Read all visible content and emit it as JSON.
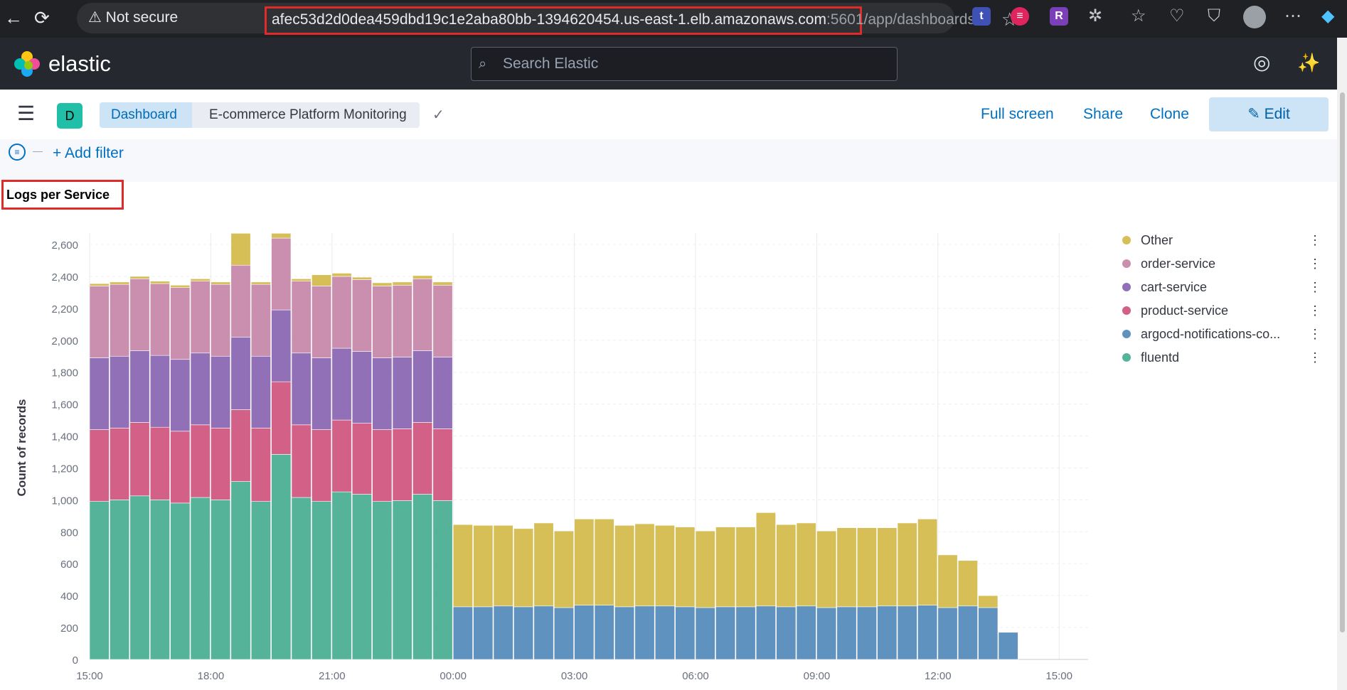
{
  "browser": {
    "back_icon": "←",
    "reload_icon": "⟳",
    "security_label": "Not secure",
    "url_main": "afec53d2d0dea459dbd19c1e2aba80bb-1394620454.us-east-1.elb.amazonaws.com",
    "url_port": ":5601/app/dashboards#/...",
    "extensions": [
      {
        "name": "t",
        "color": "#3f51b5"
      },
      {
        "name": "≡",
        "color": "#e0245e"
      },
      {
        "name": "R",
        "color": "#7b3fb8"
      }
    ]
  },
  "kibana": {
    "brand": "elastic",
    "search_placeholder": "Search Elastic"
  },
  "toolbar": {
    "space_initial": "D",
    "breadcrumb_root": "Dashboard",
    "breadcrumb_current": "E-commerce Platform Monitoring",
    "full_screen": "Full screen",
    "share": "Share",
    "clone": "Clone",
    "edit": "Edit"
  },
  "filter": {
    "add_filter": "+ Add filter"
  },
  "panel": {
    "title": "Logs per Service"
  },
  "legend": [
    {
      "name": "Other",
      "color": "#d6bf57"
    },
    {
      "name": "order-service",
      "color": "#ca8eae"
    },
    {
      "name": "cart-service",
      "color": "#9170b8"
    },
    {
      "name": "product-service",
      "color": "#d36086"
    },
    {
      "name": "argocd-notifications-co...",
      "color": "#6092c0"
    },
    {
      "name": "fluentd",
      "color": "#54b399"
    }
  ],
  "chart_data": {
    "type": "bar",
    "stacked": true,
    "ylabel": "Count of records",
    "ylim": [
      0,
      2700
    ],
    "yticks": [
      0,
      200,
      400,
      600,
      800,
      1000,
      1200,
      1400,
      1600,
      1800,
      2000,
      2200,
      2400,
      2600
    ],
    "xticks": [
      "15:00",
      "18:00",
      "21:00",
      "00:00",
      "03:00",
      "06:00",
      "09:00",
      "12:00",
      "15:00"
    ],
    "x_start": "15:00",
    "bucket_minutes": 30,
    "series": [
      {
        "name": "fluentd",
        "color": "#54b399",
        "values": [
          990,
          1000,
          1025,
          1000,
          980,
          1015,
          1000,
          1115,
          990,
          1285,
          1015,
          990,
          1050,
          1035,
          990,
          995,
          1035,
          995,
          0,
          0,
          0,
          0,
          0,
          0,
          0,
          0,
          0,
          0,
          0,
          0,
          0,
          0,
          0,
          0,
          0,
          0,
          0,
          0,
          0,
          0,
          0,
          0,
          0,
          0,
          0,
          0,
          0
        ]
      },
      {
        "name": "argocd-notifications-co...",
        "color": "#6092c0",
        "values": [
          0,
          0,
          0,
          0,
          0,
          0,
          0,
          0,
          0,
          0,
          0,
          0,
          0,
          0,
          0,
          0,
          0,
          0,
          330,
          330,
          335,
          330,
          335,
          325,
          340,
          340,
          330,
          335,
          335,
          330,
          325,
          330,
          330,
          335,
          330,
          335,
          325,
          330,
          330,
          335,
          335,
          340,
          325,
          335,
          325,
          170,
          0
        ]
      },
      {
        "name": "product-service",
        "color": "#d36086",
        "values": [
          450,
          450,
          460,
          455,
          450,
          455,
          450,
          450,
          460,
          455,
          455,
          450,
          450,
          445,
          450,
          450,
          450,
          450,
          0,
          0,
          0,
          0,
          0,
          0,
          0,
          0,
          0,
          0,
          0,
          0,
          0,
          0,
          0,
          0,
          0,
          0,
          0,
          0,
          0,
          0,
          0,
          0,
          0,
          0,
          0,
          0,
          0
        ]
      },
      {
        "name": "cart-service",
        "color": "#9170b8",
        "values": [
          450,
          450,
          450,
          450,
          450,
          450,
          450,
          455,
          450,
          450,
          450,
          450,
          450,
          450,
          450,
          450,
          450,
          450,
          0,
          0,
          0,
          0,
          0,
          0,
          0,
          0,
          0,
          0,
          0,
          0,
          0,
          0,
          0,
          0,
          0,
          0,
          0,
          0,
          0,
          0,
          0,
          0,
          0,
          0,
          0,
          0,
          0
        ]
      },
      {
        "name": "order-service",
        "color": "#ca8eae",
        "values": [
          450,
          450,
          450,
          450,
          450,
          450,
          450,
          450,
          450,
          450,
          450,
          450,
          450,
          450,
          450,
          450,
          450,
          450,
          0,
          0,
          0,
          0,
          0,
          0,
          0,
          0,
          0,
          0,
          0,
          0,
          0,
          0,
          0,
          0,
          0,
          0,
          0,
          0,
          0,
          0,
          0,
          0,
          0,
          0,
          0,
          0,
          0
        ]
      },
      {
        "name": "Other",
        "color": "#d6bf57",
        "values": [
          15,
          15,
          15,
          15,
          15,
          15,
          15,
          200,
          15,
          30,
          15,
          70,
          20,
          15,
          20,
          20,
          20,
          20,
          515,
          510,
          505,
          490,
          520,
          480,
          540,
          540,
          510,
          515,
          505,
          500,
          480,
          500,
          500,
          585,
          515,
          520,
          480,
          495,
          495,
          490,
          520,
          540,
          330,
          285,
          75,
          0,
          0
        ]
      }
    ]
  }
}
